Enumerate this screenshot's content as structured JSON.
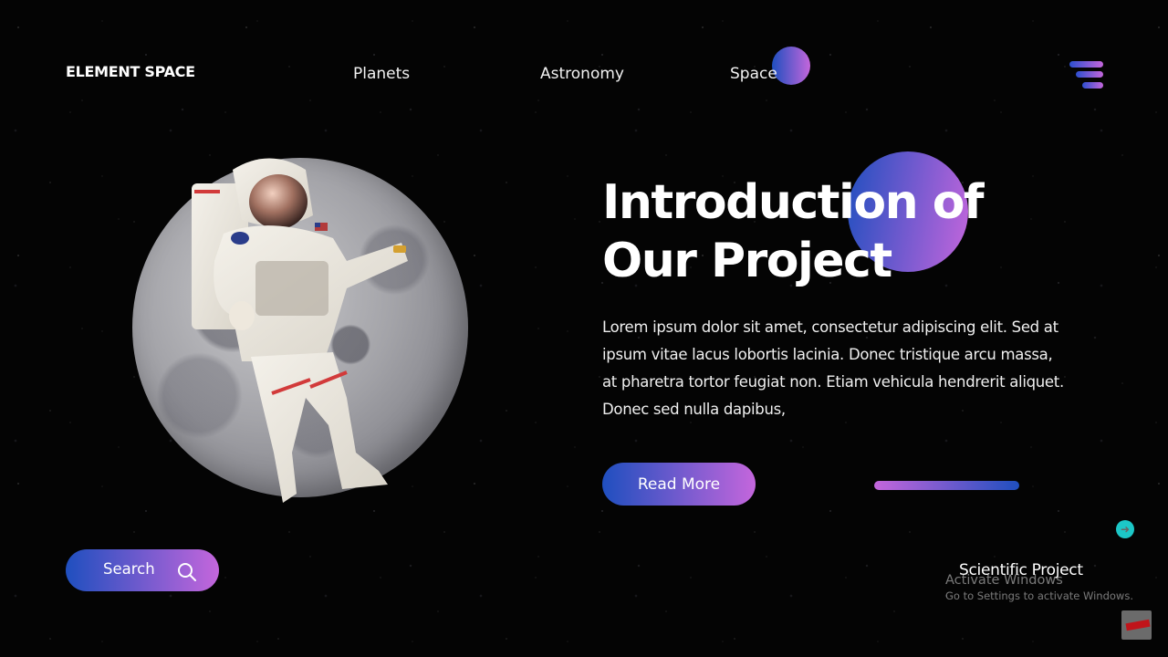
{
  "brand": {
    "name": "ELEMENT SPACE"
  },
  "nav": {
    "items": [
      {
        "label": "Planets"
      },
      {
        "label": "Astronomy"
      },
      {
        "label": "Space"
      }
    ],
    "menu_icon": "hamburger-menu-icon"
  },
  "hero": {
    "title_line1": "Introduction of",
    "title_line2": "Our Project",
    "paragraph": "Lorem ipsum dolor sit amet, consectetur adipiscing elit. Sed at ipsum vitae lacus lobortis lacinia. Donec tristique arcu massa, at pharetra tortor feugiat non. Etiam vehicula hendrerit aliquet. Donec sed nulla dapibus,",
    "read_more_label": "Read More",
    "image": "astronaut-on-moon"
  },
  "search": {
    "label": "Search",
    "icon": "search-icon"
  },
  "footer": {
    "label": "Scientific Project"
  },
  "scroll_button": {
    "icon": "arrow-right-icon"
  },
  "os_overlay": {
    "activate_title": "Activate Windows",
    "activate_subtitle": "Go to Settings to activate Windows."
  },
  "colors": {
    "gradient_start": "#1f4fbf",
    "gradient_end": "#c466dc",
    "background": "#040404",
    "scroll_button": "#1cc7c7"
  }
}
